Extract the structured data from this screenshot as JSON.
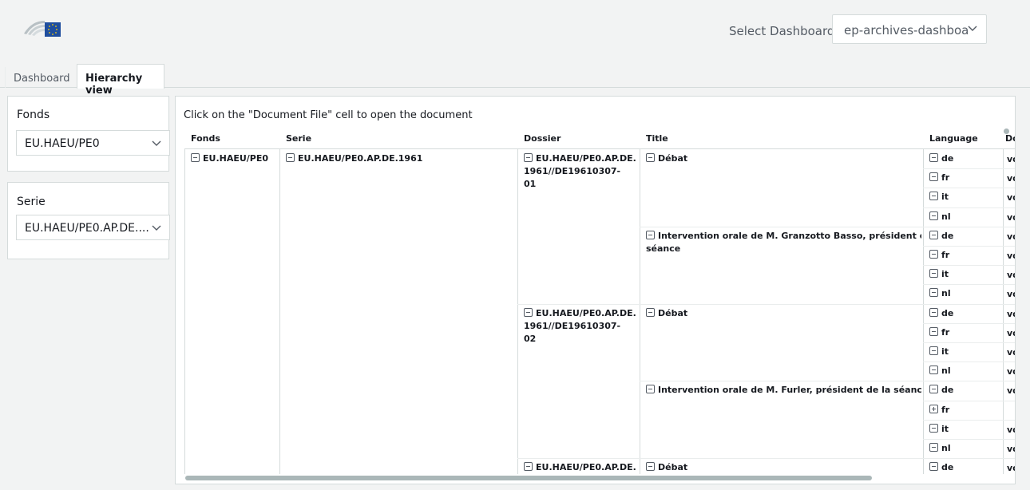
{
  "header": {
    "select_label": "Select Dashboard",
    "select_value": "ep-archives-dashboa"
  },
  "tabs": [
    {
      "label": "Dashboard",
      "active": false
    },
    {
      "label": "Hierarchy view",
      "active": true
    }
  ],
  "filters": {
    "fonds": {
      "title": "Fonds",
      "value": "EU.HAEU/PE0"
    },
    "serie": {
      "title": "Serie",
      "value": "EU.HAEU/PE0.AP.DE...."
    }
  },
  "main": {
    "instruction": "Click on the \"Document File\" cell to open the document",
    "columns": [
      "Fonds",
      "Serie",
      "Dossier",
      "Title",
      "Language",
      "Dc"
    ],
    "fonds": "EU.HAEU/PE0",
    "serie": "EU.HAEU/PE0.AP.DE.1961",
    "dossiers": [
      {
        "lines": [
          "EU.HAEU/PE0.AP.DE.",
          "1961//DE19610307-",
          "01"
        ]
      },
      {
        "lines": [
          "EU.HAEU/PE0.AP.DE.",
          "1961//DE19610307-",
          "02"
        ]
      },
      {
        "lines": [
          "EU.HAEU/PE0.AP.DE."
        ]
      }
    ],
    "titles": [
      {
        "lines": [
          "Débat"
        ]
      },
      {
        "lines": [
          "Intervention orale de M. Granzotto Basso, président de la",
          "séance"
        ]
      },
      {
        "lines": [
          "Débat"
        ]
      },
      {
        "lines": [
          "Intervention orale de M. Furler, président de la séance"
        ]
      },
      {
        "lines": [
          "Débat"
        ]
      }
    ],
    "languages": [
      {
        "code": "de",
        "expanded": true,
        "doc": "vo"
      },
      {
        "code": "fr",
        "expanded": true,
        "doc": "vo"
      },
      {
        "code": "it",
        "expanded": true,
        "doc": "vo"
      },
      {
        "code": "nl",
        "expanded": true,
        "doc": "vo"
      },
      {
        "code": "de",
        "expanded": true,
        "doc": "vo"
      },
      {
        "code": "fr",
        "expanded": true,
        "doc": "vo"
      },
      {
        "code": "it",
        "expanded": true,
        "doc": "vo"
      },
      {
        "code": "nl",
        "expanded": true,
        "doc": "vo"
      },
      {
        "code": "de",
        "expanded": true,
        "doc": "vo"
      },
      {
        "code": "fr",
        "expanded": true,
        "doc": "vo"
      },
      {
        "code": "it",
        "expanded": true,
        "doc": "vo"
      },
      {
        "code": "nl",
        "expanded": true,
        "doc": "vo"
      },
      {
        "code": "de",
        "expanded": true,
        "doc": "vo"
      },
      {
        "code": "fr",
        "expanded": false,
        "doc": ""
      },
      {
        "code": "it",
        "expanded": true,
        "doc": "vo"
      },
      {
        "code": "nl",
        "expanded": true,
        "doc": "vo"
      },
      {
        "code": "de",
        "expanded": true,
        "doc": "vo"
      }
    ]
  },
  "colors": {
    "background": "#f2f3f3",
    "border": "#d5dbdb",
    "text": "#16191f",
    "muted": "#545b64",
    "logo_blue": "#1f4e9e",
    "logo_gold": "#ffd200"
  },
  "icons": {
    "logo": "european-parliament-logo",
    "chevron": "chevron-down-icon",
    "collapse": "minus-square-icon",
    "expand": "plus-square-icon"
  }
}
